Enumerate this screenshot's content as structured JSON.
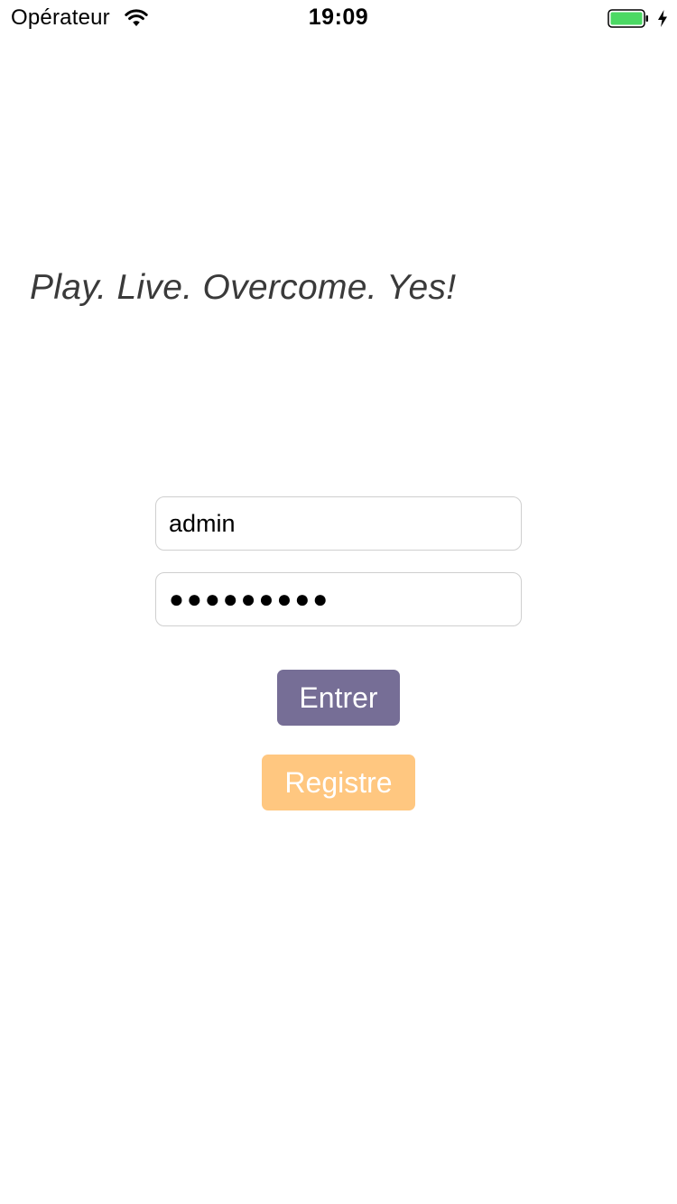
{
  "status_bar": {
    "carrier": "Opérateur",
    "time": "19:09",
    "icons": {
      "wifi": "wifi-icon",
      "battery": "battery-icon",
      "charging": "charging-bolt-icon"
    },
    "battery_color": "#4cd964"
  },
  "main": {
    "tagline": "Play. Live. Overcome. Yes!",
    "username_value": "admin",
    "password_masked": "●●●●●●●●●"
  },
  "buttons": {
    "enter_label": "Entrer",
    "enter_color": "#766e96",
    "register_label": "Registre",
    "register_color": "#ffc780"
  }
}
